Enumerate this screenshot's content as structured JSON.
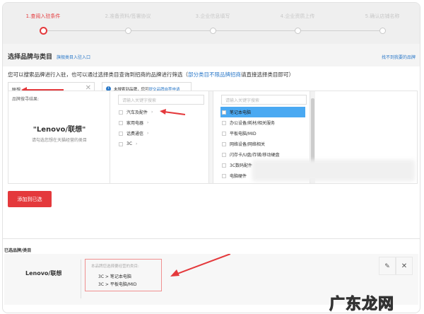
{
  "steps": [
    {
      "label": "1.查阅入驻条件",
      "active": true
    },
    {
      "label": "2.准备资料/签署协议"
    },
    {
      "label": "3.企业信息填写"
    },
    {
      "label": "4.企业资质上传"
    },
    {
      "label": "5.确认店铺名称"
    }
  ],
  "section": {
    "title": "选择品牌与类目",
    "sub_link": "旗舰类目入驻入口",
    "right_link": "找不到我要的品牌"
  },
  "intro": {
    "text": "您可以搜索品牌进行入驻，也可以通过选择类目查询到招商的品牌进行筛选（",
    "link": "部分类目不限品牌招商",
    "tail": "请直接选择类目即可）"
  },
  "search": {
    "value": "联想"
  },
  "notice": {
    "text": "未搜索到品牌，您可",
    "link": "提交品牌自荐申请"
  },
  "result": {
    "label": "品牌搜寻结果:",
    "brand": "\"Lenovo/联想\"",
    "hint": "请勾选您想在天猫经营的类目"
  },
  "col1": {
    "placeholder": "请输入关键字搜索",
    "items": [
      "汽车及配件",
      "家用电器",
      "话费通信",
      "3C"
    ]
  },
  "col2": {
    "placeholder": "请输入关键字搜索",
    "items": [
      "笔记本电脑",
      "办公设备/耗材/相关服务",
      "平板电脑/MID",
      "网络设备/网络相关",
      "闪存卡/U盘/存储/移动硬盘",
      "3C数码配件",
      "电脑硬件"
    ]
  },
  "add_button": "添加到已选",
  "selected": {
    "title": "已选品牌/类目",
    "brand": "Lenovo/联想",
    "box_label": "本品牌您选择要经营的类目:",
    "cats": [
      "3C > 笔记本电脑",
      "3C > 平板电脑/MID"
    ]
  },
  "watermark": "广东龙网",
  "colors": {
    "accent": "#e4393c",
    "link": "#2d7ac9",
    "highlight": "#4aa9f2"
  }
}
